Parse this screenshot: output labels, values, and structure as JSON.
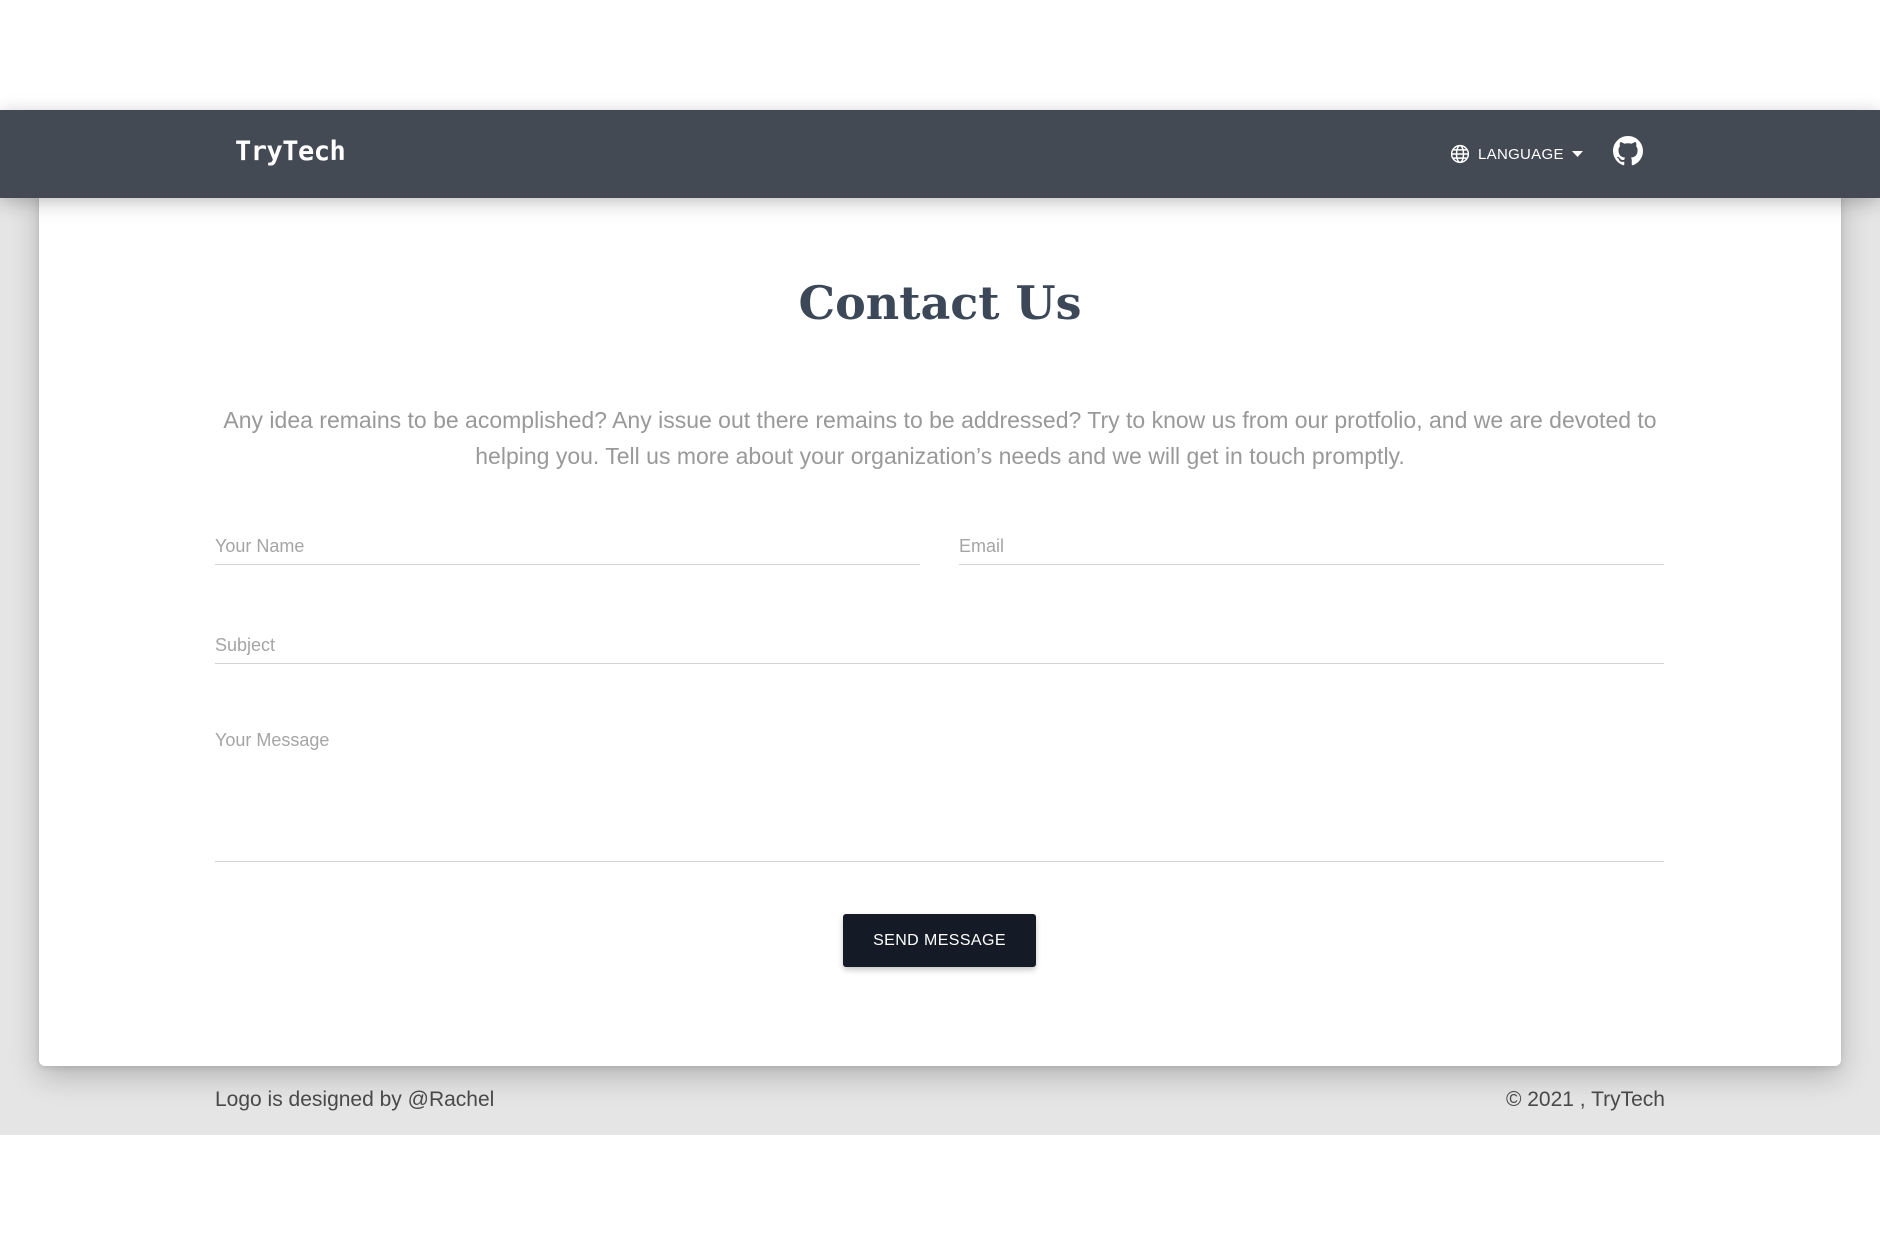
{
  "navbar": {
    "brand": "TryTech",
    "language_label": "LANGUAGE",
    "language_icon": "globe-icon",
    "dropdown_icon": "caret-down-icon",
    "github_icon": "github-icon",
    "background_color": "#434a54"
  },
  "contact": {
    "title": "Contact Us",
    "description": "Any idea remains to be acomplished? Any issue out there remains to be addressed? Try to know us from our protfolio, and we are devoted to helping you. Tell us more about your organization’s needs and we will get in touch promptly.",
    "form": {
      "name_placeholder": "Your Name",
      "email_placeholder": "Email",
      "subject_placeholder": "Subject",
      "message_placeholder": "Your Message",
      "name_value": "",
      "email_value": "",
      "subject_value": "",
      "message_value": "",
      "submit_label": "SEND MESSAGE",
      "submit_color": "#151b26"
    }
  },
  "footer": {
    "credit": "Logo is designed by @Rachel",
    "copyright": "© 2021 , TryTech"
  }
}
